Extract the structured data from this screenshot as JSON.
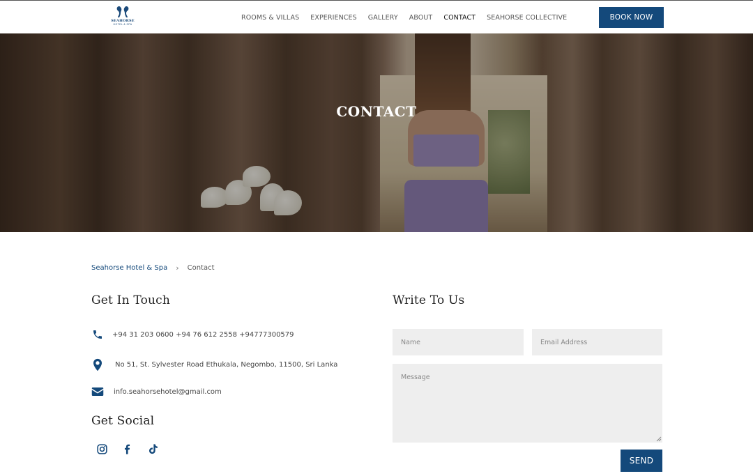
{
  "header": {
    "logo_text": "SEAHORSE",
    "logo_sub": "HOTEL & SPA",
    "nav": [
      {
        "label": "ROOMS & VILLAS",
        "active": false
      },
      {
        "label": "EXPERIENCES",
        "active": false
      },
      {
        "label": "GALLERY",
        "active": false
      },
      {
        "label": "ABOUT",
        "active": false
      },
      {
        "label": "CONTACT",
        "active": true
      },
      {
        "label": "SEAHORSE COLLECTIVE",
        "active": false
      }
    ],
    "book_label": "BOOK NOW"
  },
  "hero": {
    "title": "CONTACT"
  },
  "breadcrumb": {
    "home": "Seahorse Hotel & Spa",
    "separator": "›",
    "current": "Contact"
  },
  "contact": {
    "heading": "Get In Touch",
    "phone": "+94 31 203 0600 +94 76 612 2558 +94777300579",
    "address": "No 51, St. Sylvester Road Ethukala, Negombo, 11500, Sri Lanka",
    "email": "info.seahorsehotel@gmail.com",
    "icons": {
      "phone": "phone-icon",
      "address": "map-pin-icon",
      "email": "envelope-icon"
    }
  },
  "social": {
    "heading": "Get Social",
    "items": [
      {
        "icon": "instagram-icon"
      },
      {
        "icon": "facebook-icon"
      },
      {
        "icon": "tiktok-icon"
      }
    ]
  },
  "form": {
    "heading": "Write To Us",
    "name_placeholder": "Name",
    "email_placeholder": "Email Address",
    "message_placeholder": "Message",
    "send_label": "SEND"
  },
  "colors": {
    "brand": "#14497b",
    "field_bg": "#eeeeee",
    "heading": "#222222"
  }
}
